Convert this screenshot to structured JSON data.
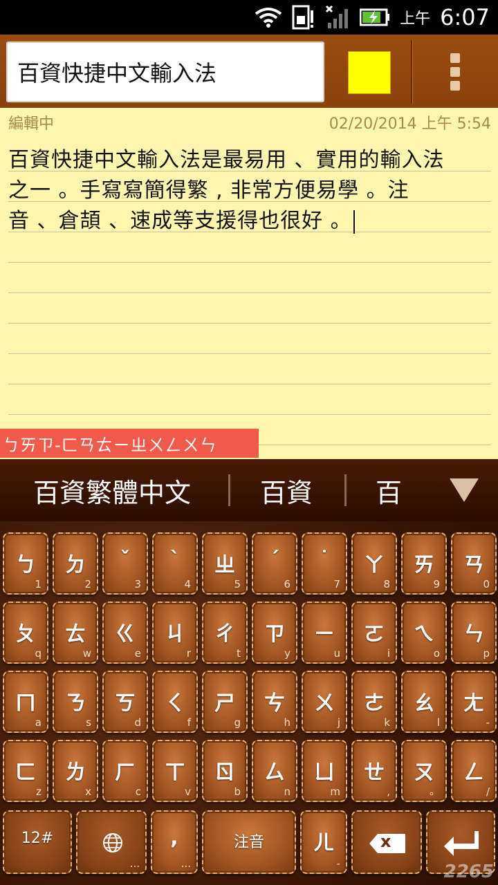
{
  "status_bar": {
    "ampm": "上午",
    "time": "6:07"
  },
  "title_bar": {
    "title": "百資快捷中文輸入法",
    "swatch_color": "#ffff00"
  },
  "note": {
    "status": "編輯中",
    "timestamp": "02/20/2014 上午 5:54",
    "lines": [
      "百資快捷中文輸入法是最易用 、實用的輸入法",
      "之一 。手寫寫簡得繁 , 非常方便易學 。注",
      "音 、倉頡 、速成等支援得也很好 。"
    ],
    "composition": "ㄅㄞㄗ-ㄈㄢㄊㄧㄓㄨㄥㄨㄣ"
  },
  "candidates": [
    "百資繁體中文",
    "百資",
    "百"
  ],
  "keyboard": {
    "rows": [
      [
        {
          "k": "ㄅ",
          "s": "1"
        },
        {
          "k": "ㄉ",
          "s": "2"
        },
        {
          "k": "ˇ",
          "s": "3"
        },
        {
          "k": "ˋ",
          "s": "4"
        },
        {
          "k": "ㄓ",
          "s": "5"
        },
        {
          "k": "ˊ",
          "s": "6"
        },
        {
          "k": "˙",
          "s": "7"
        },
        {
          "k": "ㄚ",
          "s": "8"
        },
        {
          "k": "ㄞ",
          "s": "9"
        },
        {
          "k": "ㄢ",
          "s": "0"
        }
      ],
      [
        {
          "k": "ㄆ",
          "s": "q"
        },
        {
          "k": "ㄊ",
          "s": "w"
        },
        {
          "k": "ㄍ",
          "s": "e"
        },
        {
          "k": "ㄐ",
          "s": "r"
        },
        {
          "k": "ㄔ",
          "s": "t"
        },
        {
          "k": "ㄗ",
          "s": "y"
        },
        {
          "k": "ㄧ",
          "s": "u"
        },
        {
          "k": "ㄛ",
          "s": "i"
        },
        {
          "k": "ㄟ",
          "s": "o"
        },
        {
          "k": "ㄣ",
          "s": "p"
        }
      ],
      [
        {
          "k": "ㄇ",
          "s": "a"
        },
        {
          "k": "ㄋ",
          "s": "s"
        },
        {
          "k": "ㄎ",
          "s": "d"
        },
        {
          "k": "ㄑ",
          "s": "f"
        },
        {
          "k": "ㄕ",
          "s": "g"
        },
        {
          "k": "ㄘ",
          "s": "h"
        },
        {
          "k": "ㄨ",
          "s": "j"
        },
        {
          "k": "ㄜ",
          "s": "k"
        },
        {
          "k": "ㄠ",
          "s": "l"
        },
        {
          "k": "ㄤ",
          "s": "-"
        }
      ],
      [
        {
          "k": "ㄈ",
          "s": "z"
        },
        {
          "k": "ㄌ",
          "s": "x"
        },
        {
          "k": "ㄏ",
          "s": "c"
        },
        {
          "k": "ㄒ",
          "s": "v"
        },
        {
          "k": "ㄖ",
          "s": "b"
        },
        {
          "k": "ㄙ",
          "s": "n"
        },
        {
          "k": "ㄩ",
          "s": "m"
        },
        {
          "k": "ㄝ",
          "s": ","
        },
        {
          "k": "ㄡ",
          "s": "。"
        },
        {
          "k": "ㄥ",
          "s": "/"
        }
      ]
    ],
    "bottom": {
      "sym_label": "12#",
      "comma_label": ",",
      "comma_sub": "...",
      "globe_sub": "...",
      "space_label": "注音",
      "er_label": "ㄦ",
      "er_sub": "-",
      "backspace_label": "x"
    }
  },
  "watermark": "2265"
}
